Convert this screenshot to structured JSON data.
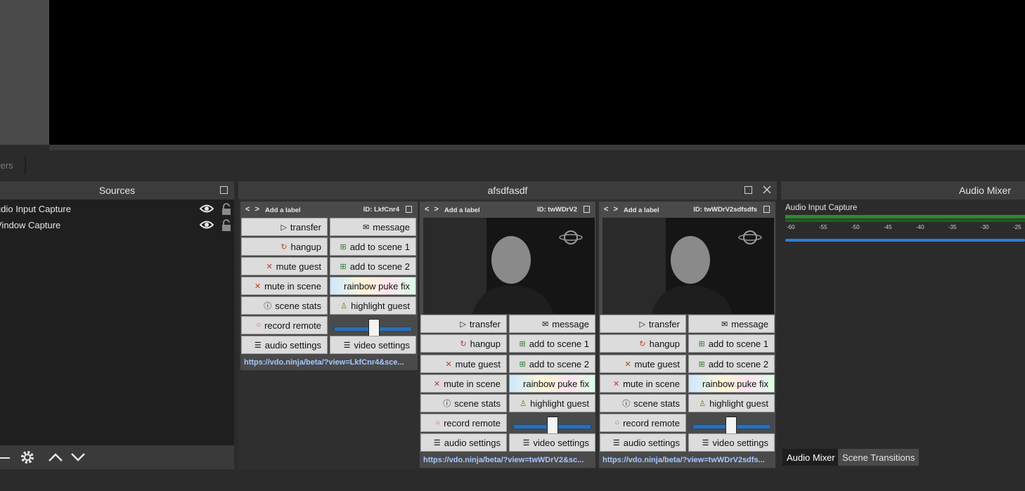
{
  "toolbar": {
    "filters_label": "ters"
  },
  "sources": {
    "title": "Sources",
    "items": [
      {
        "name": "udio Input Capture"
      },
      {
        "name": "Vindow Capture"
      }
    ]
  },
  "vdo": {
    "title": "afsdfasdf",
    "cards": [
      {
        "label": "Add a label",
        "id": "ID: LkfCnr4",
        "url": "https://vdo.ninja/beta/?view=LkfCnr4&sce...",
        "buttons": {
          "transfer": "transfer",
          "message": "message",
          "hangup": "hangup",
          "add_scene_1": "add to scene 1",
          "mute_guest": "mute guest",
          "add_scene_2": "add to scene 2",
          "mute_in_scene": "mute in scene",
          "rainbow": "rainbow puke fix",
          "scene_stats": "scene stats",
          "highlight": "highlight guest",
          "record": "record remote",
          "audio_settings": "audio settings",
          "video_settings": "video settings"
        }
      },
      {
        "label": "Add a label",
        "id": "ID: twWDrV2",
        "url": "https://vdo.ninja/beta/?view=twWDrV2&sc...",
        "buttons": {
          "transfer": "transfer",
          "message": "message",
          "hangup": "hangup",
          "add_scene_1": "add to scene 1",
          "mute_guest": "mute guest",
          "add_scene_2": "add to scene 2",
          "mute_in_scene": "mute in scene",
          "rainbow": "rainbow puke fix",
          "scene_stats": "scene stats",
          "highlight": "highlight guest",
          "record": "record remote",
          "audio_settings": "audio settings",
          "video_settings": "video settings"
        }
      },
      {
        "label": "Add a label",
        "id": "ID: twWDrV2sdfsdfs",
        "url": "https://vdo.ninja/beta/?view=twWDrV2sdfs...",
        "buttons": {
          "transfer": "transfer",
          "message": "message",
          "hangup": "hangup",
          "add_scene_1": "add to scene 1",
          "mute_guest": "mute guest",
          "add_scene_2": "add to scene 2",
          "mute_in_scene": "mute in scene",
          "rainbow": "rainbow puke fix",
          "scene_stats": "scene stats",
          "highlight": "highlight guest",
          "record": "record remote",
          "audio_settings": "audio settings",
          "video_settings": "video settings"
        }
      }
    ]
  },
  "mixer": {
    "title": "Audio Mixer",
    "source": "Audio Input Capture",
    "ticks": [
      "-60",
      "-55",
      "-50",
      "-45",
      "-40",
      "-35",
      "-30",
      "-25"
    ]
  },
  "tabs": {
    "audio_mixer": "Audio Mixer",
    "scene_transitions": "Scene Transitions"
  },
  "colors": {
    "accent": "#2f7dd6",
    "link": "#a8c8ff",
    "meter": "#2c8a2c"
  }
}
